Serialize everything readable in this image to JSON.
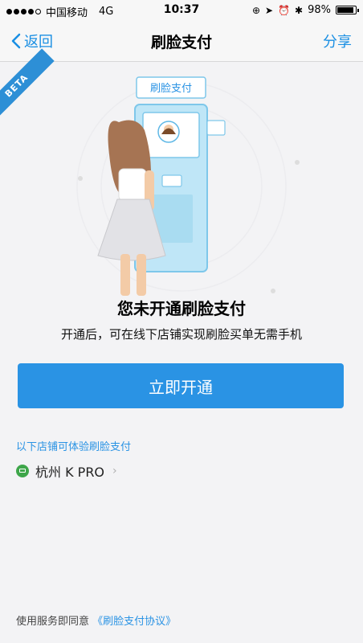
{
  "status_bar": {
    "carrier": "中国移动",
    "network": "4G",
    "time": "10:37",
    "battery_text": "98%",
    "battery_level": 0.98
  },
  "nav": {
    "back_label": "返回",
    "title": "刷脸支付",
    "share_label": "分享"
  },
  "beta_badge": "BETA",
  "illustration": {
    "screen_label": "刷脸支付"
  },
  "main": {
    "headline": "您未开通刷脸支付",
    "subtext": "开通后，可在线下店铺实现刷脸买单无需手机",
    "primary_button": "立即开通"
  },
  "stores": {
    "title": "以下店铺可体验刷脸支付",
    "items": [
      {
        "name": "杭州 K PRO"
      }
    ]
  },
  "footer": {
    "prefix": "使用服务即同意",
    "agreement_link": "《刷脸支付协议》"
  },
  "colors": {
    "accent": "#2a93e4",
    "beta": "#2d8fd6",
    "store_icon": "#3ea64a",
    "background": "#f3f3f5"
  }
}
